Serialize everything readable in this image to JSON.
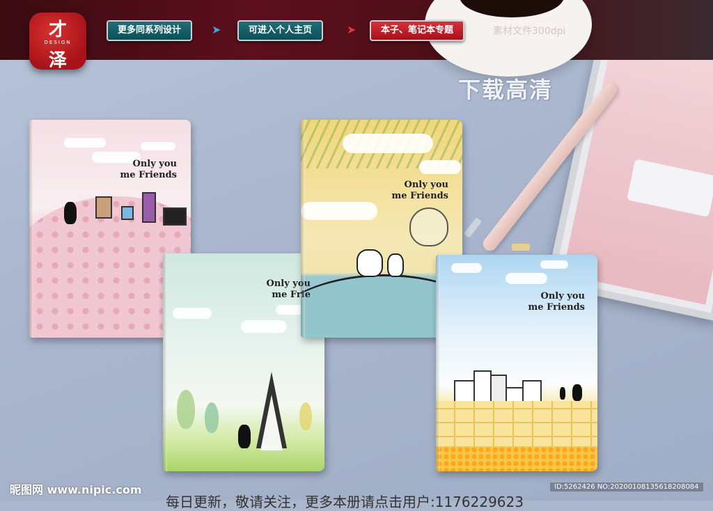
{
  "brand": {
    "logo_char_top": "才",
    "logo_text": "DESIGN",
    "logo_char_bottom": "泽"
  },
  "nav": {
    "buttons": [
      {
        "label": "更多同系列设计",
        "style": "teal"
      },
      {
        "label": "可进入个人主页",
        "style": "teal"
      },
      {
        "label": "本子、笔记本专题",
        "style": "red"
      }
    ],
    "arrows": [
      "➤",
      "➤"
    ],
    "file_meta": "素材文件300dpi"
  },
  "download_label": "下载高清",
  "notebooks": [
    {
      "title_line1": "Only you",
      "title_line2": "me Friends"
    },
    {
      "title_line1": "Only you",
      "title_line2": "me Frie"
    },
    {
      "title_line1": "Only you",
      "title_line2": "me Friends"
    },
    {
      "title_line1": "Only you",
      "title_line2": "me Friends"
    }
  ],
  "footer": {
    "site": "昵图网 www.nipic.com",
    "id_text": "ID:5262426 NO:20200108135618208084",
    "note": "每日更新，敬请关注，更多本册请点击用户:1176229623"
  },
  "colors": {
    "topbar": "#4a0f18",
    "nav_teal": "#0e4e57",
    "nav_red": "#a3121c",
    "background": "#aab7cd"
  }
}
